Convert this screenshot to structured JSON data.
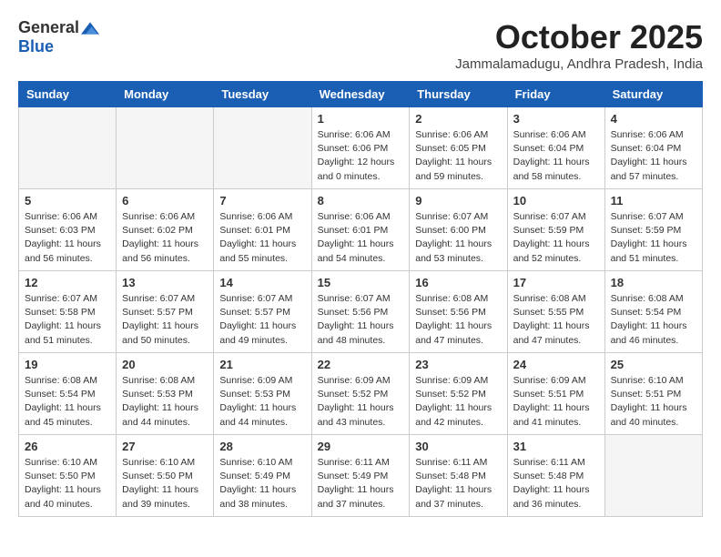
{
  "header": {
    "logo_general": "General",
    "logo_blue": "Blue",
    "month_title": "October 2025",
    "location": "Jammalamadugu, Andhra Pradesh, India"
  },
  "days_of_week": [
    "Sunday",
    "Monday",
    "Tuesday",
    "Wednesday",
    "Thursday",
    "Friday",
    "Saturday"
  ],
  "weeks": [
    [
      {
        "day": "",
        "sunrise": "",
        "sunset": "",
        "daylight": ""
      },
      {
        "day": "",
        "sunrise": "",
        "sunset": "",
        "daylight": ""
      },
      {
        "day": "",
        "sunrise": "",
        "sunset": "",
        "daylight": ""
      },
      {
        "day": "1",
        "sunrise": "Sunrise: 6:06 AM",
        "sunset": "Sunset: 6:06 PM",
        "daylight": "Daylight: 12 hours and 0 minutes."
      },
      {
        "day": "2",
        "sunrise": "Sunrise: 6:06 AM",
        "sunset": "Sunset: 6:05 PM",
        "daylight": "Daylight: 11 hours and 59 minutes."
      },
      {
        "day": "3",
        "sunrise": "Sunrise: 6:06 AM",
        "sunset": "Sunset: 6:04 PM",
        "daylight": "Daylight: 11 hours and 58 minutes."
      },
      {
        "day": "4",
        "sunrise": "Sunrise: 6:06 AM",
        "sunset": "Sunset: 6:04 PM",
        "daylight": "Daylight: 11 hours and 57 minutes."
      }
    ],
    [
      {
        "day": "5",
        "sunrise": "Sunrise: 6:06 AM",
        "sunset": "Sunset: 6:03 PM",
        "daylight": "Daylight: 11 hours and 56 minutes."
      },
      {
        "day": "6",
        "sunrise": "Sunrise: 6:06 AM",
        "sunset": "Sunset: 6:02 PM",
        "daylight": "Daylight: 11 hours and 56 minutes."
      },
      {
        "day": "7",
        "sunrise": "Sunrise: 6:06 AM",
        "sunset": "Sunset: 6:01 PM",
        "daylight": "Daylight: 11 hours and 55 minutes."
      },
      {
        "day": "8",
        "sunrise": "Sunrise: 6:06 AM",
        "sunset": "Sunset: 6:01 PM",
        "daylight": "Daylight: 11 hours and 54 minutes."
      },
      {
        "day": "9",
        "sunrise": "Sunrise: 6:07 AM",
        "sunset": "Sunset: 6:00 PM",
        "daylight": "Daylight: 11 hours and 53 minutes."
      },
      {
        "day": "10",
        "sunrise": "Sunrise: 6:07 AM",
        "sunset": "Sunset: 5:59 PM",
        "daylight": "Daylight: 11 hours and 52 minutes."
      },
      {
        "day": "11",
        "sunrise": "Sunrise: 6:07 AM",
        "sunset": "Sunset: 5:59 PM",
        "daylight": "Daylight: 11 hours and 51 minutes."
      }
    ],
    [
      {
        "day": "12",
        "sunrise": "Sunrise: 6:07 AM",
        "sunset": "Sunset: 5:58 PM",
        "daylight": "Daylight: 11 hours and 51 minutes."
      },
      {
        "day": "13",
        "sunrise": "Sunrise: 6:07 AM",
        "sunset": "Sunset: 5:57 PM",
        "daylight": "Daylight: 11 hours and 50 minutes."
      },
      {
        "day": "14",
        "sunrise": "Sunrise: 6:07 AM",
        "sunset": "Sunset: 5:57 PM",
        "daylight": "Daylight: 11 hours and 49 minutes."
      },
      {
        "day": "15",
        "sunrise": "Sunrise: 6:07 AM",
        "sunset": "Sunset: 5:56 PM",
        "daylight": "Daylight: 11 hours and 48 minutes."
      },
      {
        "day": "16",
        "sunrise": "Sunrise: 6:08 AM",
        "sunset": "Sunset: 5:56 PM",
        "daylight": "Daylight: 11 hours and 47 minutes."
      },
      {
        "day": "17",
        "sunrise": "Sunrise: 6:08 AM",
        "sunset": "Sunset: 5:55 PM",
        "daylight": "Daylight: 11 hours and 47 minutes."
      },
      {
        "day": "18",
        "sunrise": "Sunrise: 6:08 AM",
        "sunset": "Sunset: 5:54 PM",
        "daylight": "Daylight: 11 hours and 46 minutes."
      }
    ],
    [
      {
        "day": "19",
        "sunrise": "Sunrise: 6:08 AM",
        "sunset": "Sunset: 5:54 PM",
        "daylight": "Daylight: 11 hours and 45 minutes."
      },
      {
        "day": "20",
        "sunrise": "Sunrise: 6:08 AM",
        "sunset": "Sunset: 5:53 PM",
        "daylight": "Daylight: 11 hours and 44 minutes."
      },
      {
        "day": "21",
        "sunrise": "Sunrise: 6:09 AM",
        "sunset": "Sunset: 5:53 PM",
        "daylight": "Daylight: 11 hours and 44 minutes."
      },
      {
        "day": "22",
        "sunrise": "Sunrise: 6:09 AM",
        "sunset": "Sunset: 5:52 PM",
        "daylight": "Daylight: 11 hours and 43 minutes."
      },
      {
        "day": "23",
        "sunrise": "Sunrise: 6:09 AM",
        "sunset": "Sunset: 5:52 PM",
        "daylight": "Daylight: 11 hours and 42 minutes."
      },
      {
        "day": "24",
        "sunrise": "Sunrise: 6:09 AM",
        "sunset": "Sunset: 5:51 PM",
        "daylight": "Daylight: 11 hours and 41 minutes."
      },
      {
        "day": "25",
        "sunrise": "Sunrise: 6:10 AM",
        "sunset": "Sunset: 5:51 PM",
        "daylight": "Daylight: 11 hours and 40 minutes."
      }
    ],
    [
      {
        "day": "26",
        "sunrise": "Sunrise: 6:10 AM",
        "sunset": "Sunset: 5:50 PM",
        "daylight": "Daylight: 11 hours and 40 minutes."
      },
      {
        "day": "27",
        "sunrise": "Sunrise: 6:10 AM",
        "sunset": "Sunset: 5:50 PM",
        "daylight": "Daylight: 11 hours and 39 minutes."
      },
      {
        "day": "28",
        "sunrise": "Sunrise: 6:10 AM",
        "sunset": "Sunset: 5:49 PM",
        "daylight": "Daylight: 11 hours and 38 minutes."
      },
      {
        "day": "29",
        "sunrise": "Sunrise: 6:11 AM",
        "sunset": "Sunset: 5:49 PM",
        "daylight": "Daylight: 11 hours and 37 minutes."
      },
      {
        "day": "30",
        "sunrise": "Sunrise: 6:11 AM",
        "sunset": "Sunset: 5:48 PM",
        "daylight": "Daylight: 11 hours and 37 minutes."
      },
      {
        "day": "31",
        "sunrise": "Sunrise: 6:11 AM",
        "sunset": "Sunset: 5:48 PM",
        "daylight": "Daylight: 11 hours and 36 minutes."
      },
      {
        "day": "",
        "sunrise": "",
        "sunset": "",
        "daylight": ""
      }
    ]
  ]
}
